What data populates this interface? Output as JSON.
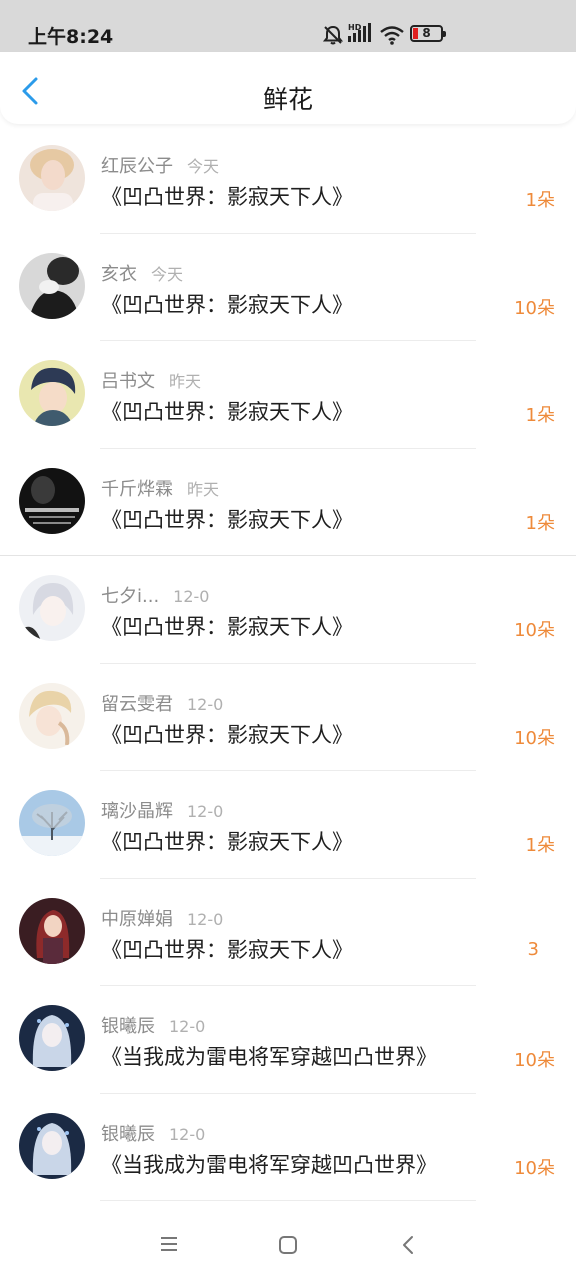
{
  "status_bar": {
    "time": "上午8:24",
    "battery_level": "8",
    "icons": [
      "alarm-off-icon",
      "hd-signal-icon",
      "wifi-icon",
      "battery-icon"
    ]
  },
  "header": {
    "title": "鲜花",
    "back_icon": "chevron-left-icon"
  },
  "colors": {
    "accent": "#2b9bea",
    "count": "#ee8a3a",
    "name": "#8c8c8c",
    "time": "#b0b0b0"
  },
  "items": [
    {
      "name": "红辰公子",
      "time": "今天",
      "book": "《凹凸世界：影寂天下人》",
      "count": "1朵"
    },
    {
      "name": "亥衣",
      "time": "今天",
      "book": "《凹凸世界：影寂天下人》",
      "count": "10朵"
    },
    {
      "name": "吕书文",
      "time": "昨天",
      "book": "《凹凸世界：影寂天下人》",
      "count": "1朵"
    },
    {
      "name": "千斤烨霖",
      "time": "昨天",
      "book": "《凹凸世界：影寂天下人》",
      "count": "1朵"
    },
    {
      "name": "七夕i...",
      "time": "12-0",
      "book": "《凹凸世界：影寂天下人》",
      "count": "10朵"
    },
    {
      "name": "留云雯君",
      "time": "12-0",
      "book": "《凹凸世界：影寂天下人》",
      "count": "10朵"
    },
    {
      "name": "璃沙晶辉",
      "time": "12-0",
      "book": "《凹凸世界：影寂天下人》",
      "count": "1朵"
    },
    {
      "name": "中原婵娟",
      "time": "12-0",
      "book": "《凹凸世界：影寂天下人》",
      "count": "3"
    },
    {
      "name": "银曦辰",
      "time": "12-0",
      "book": "《当我成为雷电将军穿越凹凸世界》",
      "count": "10朵"
    },
    {
      "name": "银曦辰",
      "time": "12-0",
      "book": "《当我成为雷电将军穿越凹凸世界》",
      "count": "10朵"
    }
  ],
  "bottom_nav": {
    "icons": [
      "menu-icon",
      "home-square-icon",
      "back-icon"
    ]
  }
}
